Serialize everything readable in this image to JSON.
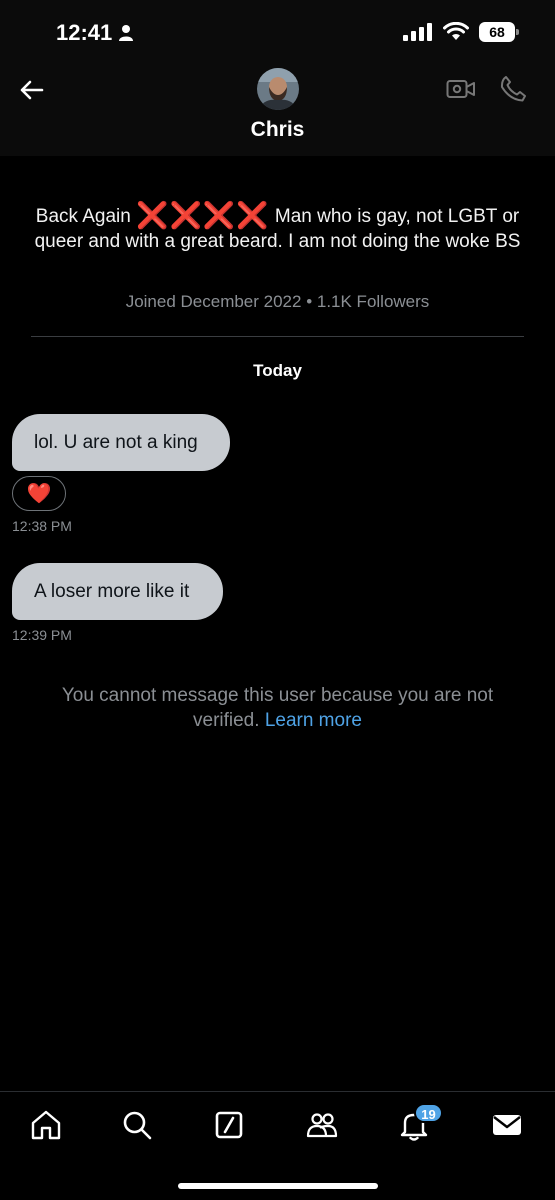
{
  "status_bar": {
    "time": "12:41",
    "battery": "68"
  },
  "header": {
    "name": "Chris"
  },
  "profile": {
    "bio_prefix": "Back Again",
    "bio_emoji": "❌❌❌❌",
    "bio_suffix": "Man who is gay, not LGBT or queer and with a great beard. I am not doing the woke BS",
    "meta": "Joined December 2022 • 1.1K Followers"
  },
  "conversation": {
    "day_label": "Today",
    "messages": [
      {
        "text": "lol. U are not a king",
        "reaction": "❤️",
        "time": "12:38 PM"
      },
      {
        "text": "A loser more like it",
        "time": "12:39 PM"
      }
    ],
    "notice_text": "You cannot message this user because you are not verified.",
    "notice_link": "Learn more"
  },
  "bottom_nav": {
    "items": [
      "home-icon",
      "search-icon",
      "compose-icon",
      "communities-icon",
      "bell-icon",
      "mail-icon"
    ],
    "notification_count": "19"
  },
  "colors": {
    "background": "#000000",
    "bubble": "#c7cbd0",
    "link": "#4fa3e6",
    "muted": "#8b8f94",
    "x_mark": "#e8242f"
  }
}
